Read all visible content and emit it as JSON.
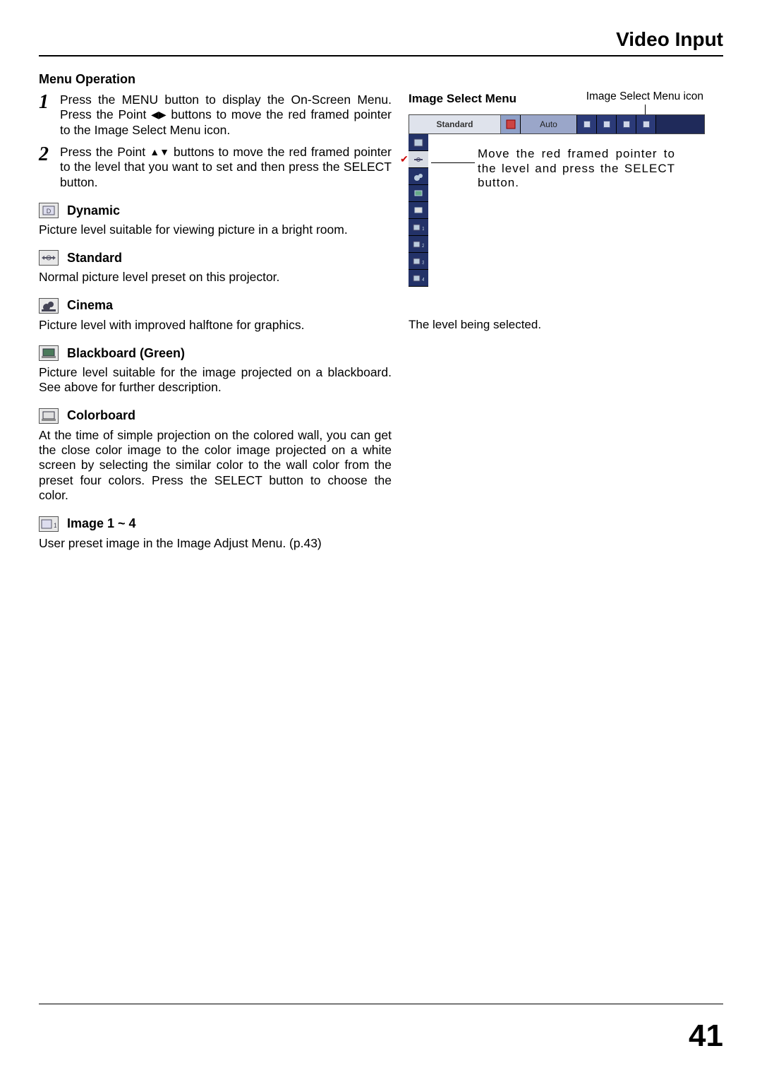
{
  "header": {
    "title": "Video Input"
  },
  "left": {
    "heading": "Menu Operation",
    "steps": [
      {
        "num": "1",
        "text_a": "Press the MENU button to display the On-Screen Menu.  Press the Point ",
        "text_b": " buttons to move the red framed pointer to the Image Select Menu icon."
      },
      {
        "num": "2",
        "text_a": "Press the Point ",
        "text_b": " buttons to move the red framed pointer to the level that you want to set and then press the SELECT button."
      }
    ],
    "modes": [
      {
        "key": "dynamic",
        "title": "Dynamic",
        "desc": "Picture level suitable for viewing picture in a bright room."
      },
      {
        "key": "standard",
        "title": "Standard",
        "desc": "Normal picture level preset on this projector."
      },
      {
        "key": "cinema",
        "title": "Cinema",
        "desc": "Picture level with improved halftone for graphics."
      },
      {
        "key": "blackboard",
        "title": "Blackboard (Green)",
        "desc": "Picture level suitable for the image projected on a blackboard.  See above for further description."
      },
      {
        "key": "colorboard",
        "title": "Colorboard",
        "desc": "At the time of simple projection on the colored wall, you can get the close color image to the color image projected on a white screen by selecting the similar color to the wall color from the preset four colors. Press the SELECT button to choose the color."
      },
      {
        "key": "image14",
        "title": "Image 1 ~ 4",
        "desc": "User preset image in the Image Adjust Menu. (p.43)"
      }
    ]
  },
  "right": {
    "icon_callout": "Image Select Menu icon",
    "heading": "Image Select Menu",
    "menubar": {
      "name": "Standard",
      "auto": "Auto"
    },
    "callout": "Move the red framed pointer to the level and press the SELECT button.",
    "caption": "The level being selected."
  },
  "pagenum": "41"
}
